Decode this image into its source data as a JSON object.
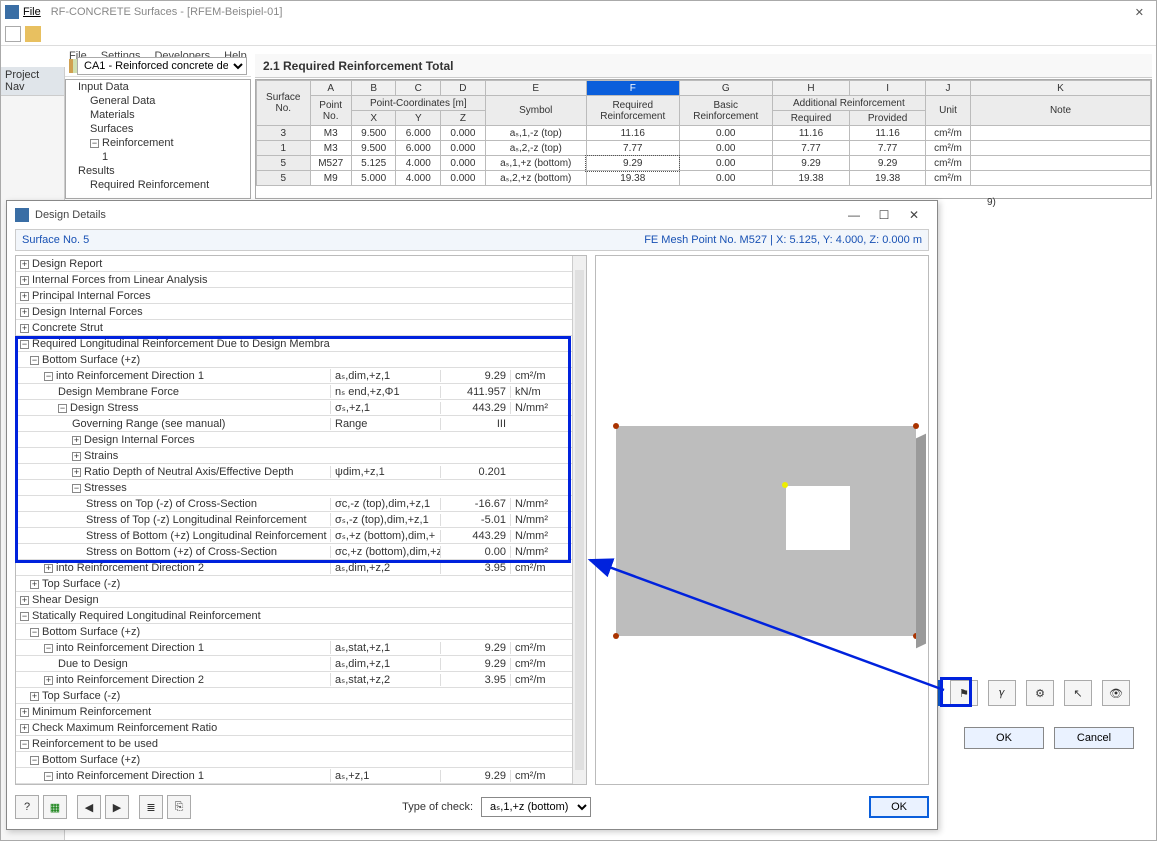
{
  "titlebar": {
    "text": "RF-CONCRETE Surfaces - [RFEM-Beispiel-01]",
    "file_label": "File"
  },
  "menubar": {
    "file": "File",
    "settings": "Settings",
    "developers": "Developers",
    "help": "Help"
  },
  "case_select": "CA1 - Reinforced concrete desi",
  "left_pane_header": "Project Nav",
  "tree": {
    "input": "Input Data",
    "general": "General Data",
    "materials": "Materials",
    "surfaces": "Surfaces",
    "reinf": "Reinforcement",
    "one": "1",
    "results": "Results",
    "req": "Required Reinforcement"
  },
  "content_title": "2.1 Required Reinforcement Total",
  "cols": {
    "A": "A",
    "B": "B",
    "C": "C",
    "D": "D",
    "E": "E",
    "F": "F",
    "G": "G",
    "H": "H",
    "I": "I",
    "J": "J",
    "K": "K",
    "surface": "Surface\nNo.",
    "point": "Point\nNo.",
    "pcoords": "Point-Coordinates [m]",
    "x": "X",
    "y": "Y",
    "z": "Z",
    "symbol": "Symbol",
    "req": "Required\nReinforcement",
    "basic": "Basic\nReinforcement",
    "addl": "Additional Reinforcement",
    "addlreq": "Required",
    "prov": "Provided",
    "unit": "Unit",
    "note": "Note"
  },
  "rows": [
    {
      "s": "3",
      "p": "M3",
      "x": "9.500",
      "y": "6.000",
      "z": "0.000",
      "sym": "aₛ,1,-z (top)",
      "req": "11.16",
      "bas": "0.00",
      "ar": "11.16",
      "pr": "11.16",
      "u": "cm²/m"
    },
    {
      "s": "1",
      "p": "M3",
      "x": "9.500",
      "y": "6.000",
      "z": "0.000",
      "sym": "aₛ,2,-z (top)",
      "req": "7.77",
      "bas": "0.00",
      "ar": "7.77",
      "pr": "7.77",
      "u": "cm²/m"
    },
    {
      "s": "5",
      "p": "M527",
      "x": "5.125",
      "y": "4.000",
      "z": "0.000",
      "sym": "aₛ,1,+z (bottom)",
      "req": "9.29",
      "bas": "0.00",
      "ar": "9.29",
      "pr": "9.29",
      "u": "cm²/m",
      "sel": true
    },
    {
      "s": "5",
      "p": "M9",
      "x": "5.000",
      "y": "4.000",
      "z": "0.000",
      "sym": "aₛ,2,+z (bottom)",
      "req": "19.38",
      "bas": "0.00",
      "ar": "19.38",
      "pr": "19.38",
      "u": "cm²/m"
    }
  ],
  "dialog": {
    "title": "Design Details",
    "surface": "Surface No. 5",
    "mesh": "FE Mesh Point No. M527  |  X: 5.125, Y: 4.000, Z: 0.000 m",
    "check_lbl": "Type of check:",
    "check_val": "aₛ,1,+z (bottom)",
    "ok": "OK"
  },
  "details": [
    {
      "lv": 0,
      "e": "+",
      "l": "Design Report"
    },
    {
      "lv": 0,
      "e": "+",
      "l": "Internal Forces from Linear Analysis"
    },
    {
      "lv": 0,
      "e": "+",
      "l": "Principal Internal Forces"
    },
    {
      "lv": 0,
      "e": "+",
      "l": "Design Internal Forces"
    },
    {
      "lv": 0,
      "e": "+",
      "l": "Concrete Strut"
    },
    {
      "lv": 0,
      "e": "−",
      "l": "Required Longitudinal Reinforcement Due to Design Membrane Forces"
    },
    {
      "lv": 1,
      "e": "−",
      "l": "Bottom Surface (+z)"
    },
    {
      "lv": 2,
      "e": "−",
      "l": "into Reinforcement Direction 1",
      "s": "aₛ,dim,+z,1",
      "v": "9.29",
      "u": "cm²/m"
    },
    {
      "lv": 3,
      "e": "",
      "l": "Design Membrane Force",
      "s": "nₛ end,+z,Φ1",
      "v": "411.957",
      "u": "kN/m"
    },
    {
      "lv": 3,
      "e": "−",
      "l": "Design Stress",
      "s": "σₛ,+z,1",
      "v": "443.29",
      "u": "N/mm²"
    },
    {
      "lv": 4,
      "e": "",
      "l": "Governing Range (see manual)",
      "s": "Range",
      "v": "III",
      "u": ""
    },
    {
      "lv": 4,
      "e": "+",
      "l": "Design Internal Forces"
    },
    {
      "lv": 4,
      "e": "+",
      "l": "Strains"
    },
    {
      "lv": 4,
      "e": "+",
      "l": "Ratio Depth of Neutral Axis/Effective Depth",
      "s": "ψdim,+z,1",
      "v": "0.201",
      "u": ""
    },
    {
      "lv": 4,
      "e": "−",
      "l": "Stresses"
    },
    {
      "lv": 5,
      "e": "",
      "l": "Stress on Top (-z) of Cross-Section",
      "s": "σc,-z (top),dim,+z,1",
      "v": "-16.67",
      "u": "N/mm²"
    },
    {
      "lv": 5,
      "e": "",
      "l": "Stress of Top (-z) Longitudinal Reinforcement",
      "s": "σₛ,-z (top),dim,+z,1",
      "v": "-5.01",
      "u": "N/mm²"
    },
    {
      "lv": 5,
      "e": "",
      "l": "Stress of Bottom (+z) Longitudinal Reinforcement",
      "s": "σₛ,+z (bottom),dim,+",
      "v": "443.29",
      "u": "N/mm²"
    },
    {
      "lv": 5,
      "e": "",
      "l": "Stress on Bottom (+z) of Cross-Section",
      "s": "σc,+z (bottom),dim,+z",
      "v": "0.00",
      "u": "N/mm²"
    },
    {
      "lv": 2,
      "e": "+",
      "l": "into Reinforcement Direction 2",
      "s": "aₛ,dim,+z,2",
      "v": "3.95",
      "u": "cm²/m"
    },
    {
      "lv": 1,
      "e": "+",
      "l": "Top Surface (-z)"
    },
    {
      "lv": 0,
      "e": "+",
      "l": "Shear Design"
    },
    {
      "lv": 0,
      "e": "−",
      "l": "Statically Required Longitudinal Reinforcement"
    },
    {
      "lv": 1,
      "e": "−",
      "l": "Bottom Surface (+z)"
    },
    {
      "lv": 2,
      "e": "−",
      "l": "into Reinforcement Direction 1",
      "s": "aₛ,stat,+z,1",
      "v": "9.29",
      "u": "cm²/m"
    },
    {
      "lv": 3,
      "e": "",
      "l": "Due to Design",
      "s": "aₛ,dim,+z,1",
      "v": "9.29",
      "u": "cm²/m"
    },
    {
      "lv": 2,
      "e": "+",
      "l": "into Reinforcement Direction 2",
      "s": "aₛ,stat,+z,2",
      "v": "3.95",
      "u": "cm²/m"
    },
    {
      "lv": 1,
      "e": "+",
      "l": "Top Surface (-z)"
    },
    {
      "lv": 0,
      "e": "+",
      "l": "Minimum Reinforcement"
    },
    {
      "lv": 0,
      "e": "+",
      "l": "Check Maximum Reinforcement Ratio"
    },
    {
      "lv": 0,
      "e": "−",
      "l": "Reinforcement to be used"
    },
    {
      "lv": 1,
      "e": "−",
      "l": "Bottom Surface (+z)"
    },
    {
      "lv": 2,
      "e": "−",
      "l": "into Reinforcement Direction 1",
      "s": "aₛ,+z,1",
      "v": "9.29",
      "u": "cm²/m"
    }
  ],
  "stray": "  9)",
  "buttons": {
    "ok": "OK",
    "cancel": "Cancel"
  }
}
